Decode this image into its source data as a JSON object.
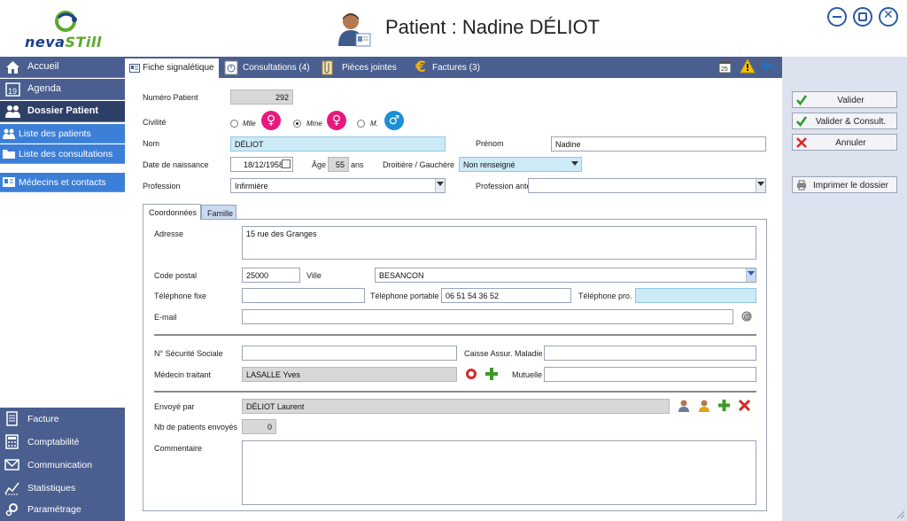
{
  "app": {
    "logo_text_1": "neva",
    "logo_text_2": "STill",
    "title": "Patient : Nadine DÉLIOT"
  },
  "window_controls": [
    "minimize-icon",
    "maximize-icon",
    "close-icon"
  ],
  "sidebar": {
    "items": [
      {
        "label": "Accueil",
        "icon": "home-icon"
      },
      {
        "label": "Agenda",
        "icon": "calendar-icon",
        "badge": "19"
      },
      {
        "label": "Dossier Patient",
        "icon": "patients-icon"
      }
    ],
    "sub_items": [
      {
        "label": "Liste des patients",
        "icon": "patients-list-icon"
      },
      {
        "label": "Liste des consultations",
        "icon": "folder-icon"
      },
      {
        "label": "Médecins et contacts",
        "icon": "contact-card-icon"
      }
    ],
    "bottom_items": [
      {
        "label": "Facture",
        "icon": "invoice-icon"
      },
      {
        "label": "Comptabilité",
        "icon": "calculator-icon"
      },
      {
        "label": "Communication",
        "icon": "envelope-icon"
      },
      {
        "label": "Statistiques",
        "icon": "chart-icon"
      },
      {
        "label": "Paramétrage",
        "icon": "settings-icon"
      }
    ]
  },
  "tabs": [
    {
      "label": "Fiche signalétique",
      "icon": "id-card-icon",
      "active": true
    },
    {
      "label": "Consultations (4)",
      "icon": "clock-icon",
      "active": false
    },
    {
      "label": "Pièces jointes",
      "icon": "attachment-icon",
      "active": false
    },
    {
      "label": "Factures (3)",
      "icon": "euro-icon",
      "active": false
    }
  ],
  "toolbar_icons": [
    "calendar-card-icon",
    "warning-icon",
    "back-arrow-icon"
  ],
  "form": {
    "numero_patient": {
      "label": "Numéro Patient",
      "value": "292"
    },
    "civilite": {
      "label": "Civilité",
      "options": [
        {
          "label": "Mlle",
          "symbol": "♀",
          "color": "#e8197c",
          "selected": false
        },
        {
          "label": "Mme",
          "symbol": "♀",
          "color": "#e8197c",
          "selected": true
        },
        {
          "label": "M.",
          "symbol": "♂",
          "color": "#1b8fd8",
          "selected": false
        }
      ]
    },
    "nom": {
      "label": "Nom",
      "value": "DÉLIOT"
    },
    "prenom": {
      "label": "Prénom",
      "value": "Nadine"
    },
    "date_naissance": {
      "label": "Date de naissance",
      "value": "18/12/1958"
    },
    "age": {
      "label": "Âge",
      "value": "55",
      "unit": "ans"
    },
    "lateralite": {
      "label": "Droitière / Gauchère",
      "value": "Non renseigné"
    },
    "profession": {
      "label": "Profession",
      "value": "Infirmière"
    },
    "profession_anterieure": {
      "label": "Profession antérieure",
      "value": ""
    }
  },
  "subtabs": [
    {
      "label": "Coordonnées",
      "active": true
    },
    {
      "label": "Famille",
      "active": false
    }
  ],
  "coordonnees": {
    "adresse": {
      "label": "Adresse",
      "value": "15 rue des Granges"
    },
    "code_postal": {
      "label": "Code postal",
      "value": "25000"
    },
    "ville": {
      "label": "Ville",
      "value": "BESANCON"
    },
    "tel_fixe": {
      "label": "Téléphone fixe",
      "value": ""
    },
    "tel_portable": {
      "label": "Téléphone portable",
      "value": "06 51 54 36 52"
    },
    "tel_pro": {
      "label": "Téléphone pro.",
      "value": ""
    },
    "email": {
      "label": "E-mail",
      "value": ""
    },
    "secu": {
      "label": "N° Sécurité Sociale",
      "value": ""
    },
    "caisse": {
      "label": "Caisse Assur. Maladie",
      "value": ""
    },
    "medecin": {
      "label": "Médecin traitant",
      "value": "LASALLE Yves"
    },
    "mutuelle": {
      "label": "Mutuelle",
      "value": ""
    },
    "envoye_par": {
      "label": "Envoyé par",
      "value": "DÉLIOT Laurent"
    },
    "nb_envoyes": {
      "label": "Nb de patients envoyés",
      "value": "0"
    },
    "commentaire": {
      "label": "Commentaire",
      "value": ""
    }
  },
  "actions": {
    "valider": "Valider",
    "valider_consult": "Valider & Consult.",
    "annuler": "Annuler",
    "imprimer": "Imprimer le dossier"
  },
  "colors": {
    "sidebar": "#4a5f8f",
    "sidebar_active": "#2e3f68",
    "sidebar_sub": "#3c7fd8",
    "highlight_field": "#cdeaf7",
    "female": "#e8197c",
    "male": "#1b8fd8"
  }
}
